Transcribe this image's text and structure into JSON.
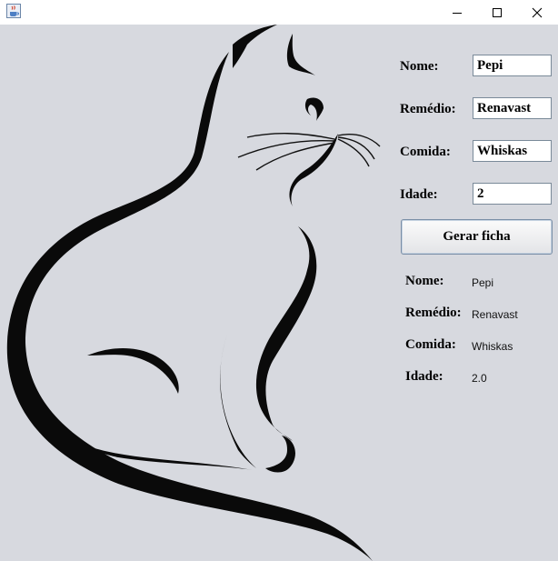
{
  "window": {
    "icon": "java-cup-icon",
    "controls": [
      "minimize-icon",
      "maximize-icon",
      "close-icon"
    ]
  },
  "form": {
    "nome_label": "Nome:",
    "nome_value": "Pepi",
    "remedio_label": "Remédio:",
    "remedio_value": "Renavast",
    "comida_label": "Comida:",
    "comida_value": "Whiskas",
    "idade_label": "Idade:",
    "idade_value": "2"
  },
  "button": {
    "label": "Gerar ficha"
  },
  "result": {
    "nome_label": "Nome:",
    "nome_value": "Pepi",
    "remedio_label": "Remédio:",
    "remedio_value": "Renavast",
    "comida_label": "Comida:",
    "comida_value": "Whiskas",
    "idade_label": "Idade:",
    "idade_value": "2.0"
  }
}
